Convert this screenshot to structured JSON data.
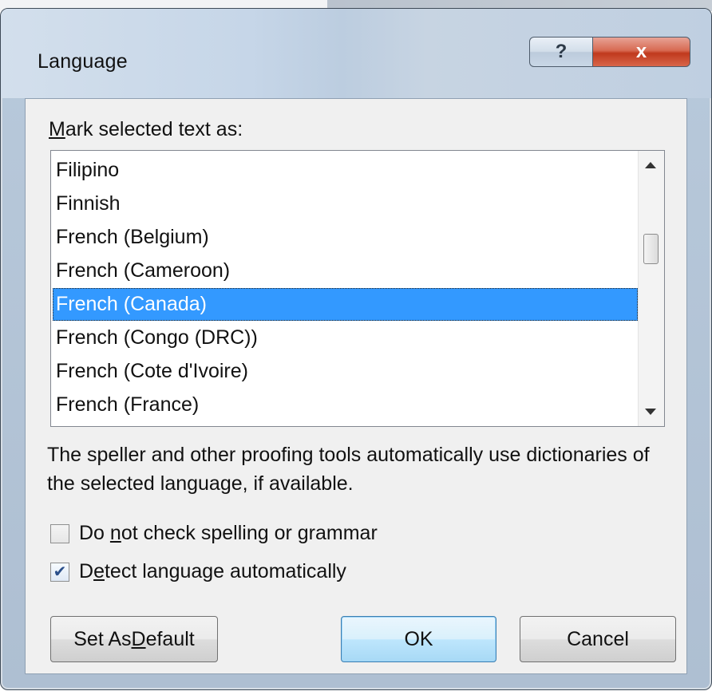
{
  "window": {
    "title": "Language",
    "help_label": "?",
    "close_label": "x"
  },
  "mark_label": {
    "prefix_underlined": "M",
    "rest": "ark selected text as:"
  },
  "languages": {
    "items": [
      "Filipino",
      "Finnish",
      "French (Belgium)",
      "French (Cameroon)",
      "French (Canada)",
      "French (Congo (DRC))",
      "French (Cote d'Ivoire)",
      "French (France)"
    ],
    "selected": "French (Canada)"
  },
  "info_text": "The speller and other proofing tools automatically use dictionaries of the selected language, if available.",
  "options": {
    "no_check": {
      "label_before": "Do ",
      "label_underlined": "n",
      "label_after": "ot check spelling or grammar",
      "checked": false
    },
    "detect": {
      "label_before": "D",
      "label_underlined": "e",
      "label_after": "tect language automatically",
      "checked": true,
      "check_glyph": "✔"
    }
  },
  "buttons": {
    "set_default_before": "Set As ",
    "set_default_underlined": "D",
    "set_default_after": "efault",
    "ok": "OK",
    "cancel": "Cancel"
  },
  "colors": {
    "selection": "#3399ff",
    "close_button": "#c0391d",
    "ok_border": "#3c7fb1"
  }
}
